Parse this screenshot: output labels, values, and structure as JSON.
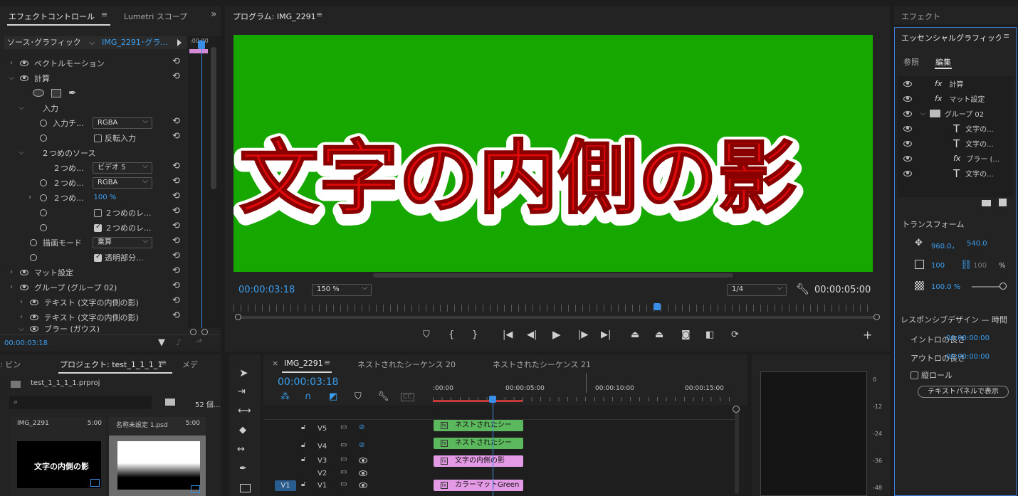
{
  "effect_controls": {
    "tab_active": "エフェクトコントロール",
    "tab_menu": "≡",
    "tab_other": "Lumetri スコープ",
    "expand": "»",
    "source_label": "ソース･グラフィック",
    "source_clip": "IMG_2291･グラ...",
    "ruler_time": ":00:00",
    "rows": [
      {
        "label": "ベクトルモーション"
      },
      {
        "label": "計算"
      },
      {
        "label": "入力"
      },
      {
        "label": "入力チ...",
        "value": "RGBA"
      },
      {
        "label": "反転入力"
      },
      {
        "label": "２つめのソース"
      },
      {
        "label": "２つめ...",
        "value": "ビデオ 5"
      },
      {
        "label": "２つめ...",
        "value": "RGBA"
      },
      {
        "label": "２つめ...",
        "value": "100 %"
      },
      {
        "label": "２つめのレ..."
      },
      {
        "label": "２つめのレ..."
      },
      {
        "label": "描画モード",
        "value": "乗算"
      },
      {
        "label": "透明部分..."
      },
      {
        "label": "マット設定"
      },
      {
        "label": "グループ (グループ 02)"
      },
      {
        "label": "テキスト (文字の内側の影)"
      },
      {
        "label": "テキスト (文字の内側の影)"
      },
      {
        "label": "ブラー (ガウス)"
      }
    ],
    "timecode": "00:00:03:18"
  },
  "program": {
    "title": "プログラム: IMG_2291",
    "menu": "≡",
    "overlay_text": "文字の内側の影",
    "bg_color": "#17a800",
    "text_color": "#e10a0a",
    "timecode": "00:00:03:18",
    "zoom": "150 %",
    "resolution": "1/4",
    "duration": "00:00:05:00"
  },
  "effects_panel": {
    "title": "エフェクト",
    "essential_title": "エッセンシャルグラフィック",
    "menu": "≡",
    "tab_browse": "参照",
    "tab_edit": "編集",
    "layers": [
      {
        "type": "fx",
        "label": "計算"
      },
      {
        "type": "fx",
        "label": "マット設定"
      },
      {
        "type": "group",
        "label": "グループ 02"
      },
      {
        "type": "text",
        "label": "文字の..."
      },
      {
        "type": "text",
        "label": "文字の..."
      },
      {
        "type": "fx",
        "label": "ブラー (..."
      },
      {
        "type": "text",
        "label": "文字の..."
      }
    ],
    "transform_title": "トランスフォーム",
    "pos_x": "960.0，",
    "pos_y": "540.0",
    "scale": "100",
    "scale2": "100",
    "percent": "%",
    "opacity": "100.0 %",
    "responsive_title": "レスポンシブデザイン — 時間",
    "intro_label": "イントロの長さ",
    "intro_value": "00:00:00:00",
    "outro_label": "アウトロの長さ",
    "outro_value": "00:00:00:00",
    "roll_label": "縦ロール",
    "text_panel_button": "テキストパネルで表示"
  },
  "project": {
    "tab_bin": ": ビン",
    "tab_project": "プロジェクト: test_1_1_1_1",
    "tab_menu": "≡",
    "tab_more": "メデ",
    "file": "test_1_1_1_1.prproj",
    "count": "52 個...",
    "items": [
      {
        "name": "IMG_2291",
        "duration": "5:00",
        "thumb_text": "文字の内側の影"
      },
      {
        "name": "名称未設定 1.psd",
        "duration": "5:00"
      }
    ]
  },
  "timeline": {
    "tab_active": "IMG_2291",
    "tab_menu": "≡",
    "tab2": "ネストされたシーケンス 20",
    "tab3": "ネストされたシーケンス 21",
    "timecode": "00:00:03:18",
    "ruler": [
      ":00:00",
      "00:00:05:00",
      "00:00:10:00",
      "00:00:15:00"
    ],
    "tracks": [
      "V5",
      "V4",
      "V3",
      "V2",
      "V1"
    ],
    "source_patch": "V1",
    "clips": [
      {
        "label": "ネストされたシー",
        "color": "#5cb85c"
      },
      {
        "label": "ネストされたシー",
        "color": "#5cb85c"
      },
      {
        "label": "文字の内側の影",
        "color": "#e59ae5"
      },
      {
        "label": "カラーマットGreen",
        "color": "#e59ae5"
      }
    ]
  },
  "meter": {
    "labels": [
      "0",
      "-12",
      "-24",
      "-36",
      "-48"
    ]
  }
}
